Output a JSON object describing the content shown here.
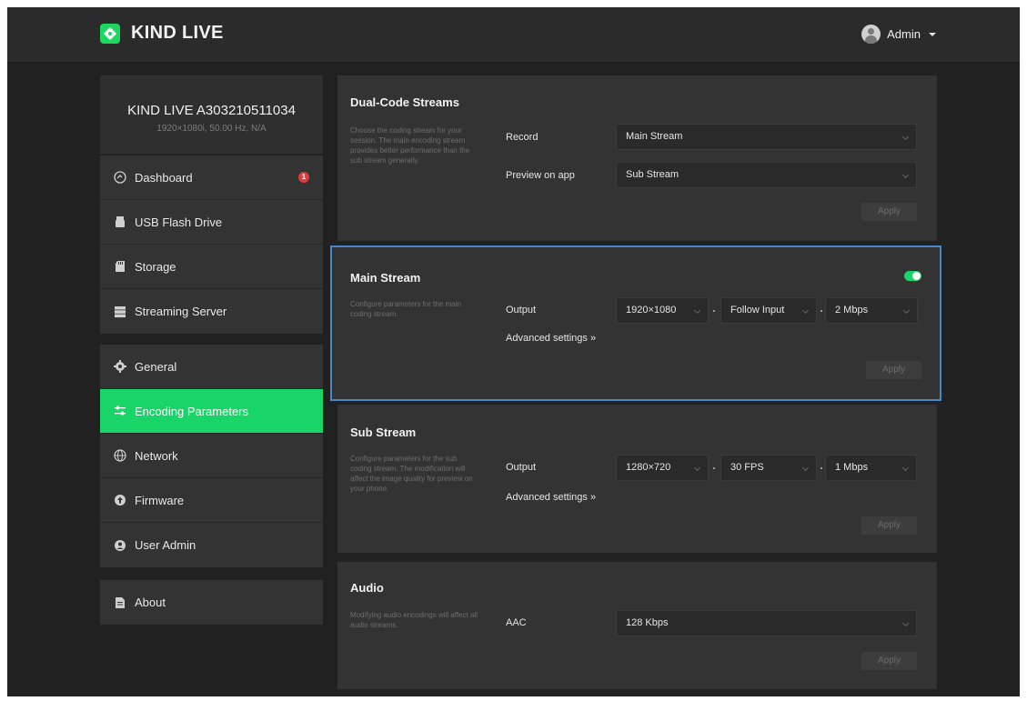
{
  "header": {
    "brand": "KIND LIVE",
    "user": "Admin"
  },
  "device": {
    "name": "KIND LIVE A303210511034",
    "info": "1920×1080i, 50.00 Hz, N/A"
  },
  "sidebar": {
    "group1": [
      {
        "label": "Dashboard",
        "icon": "dashboard-icon",
        "badge": "1"
      },
      {
        "label": "USB Flash Drive",
        "icon": "usb-drive-icon"
      },
      {
        "label": "Storage",
        "icon": "sd-card-icon"
      },
      {
        "label": "Streaming Server",
        "icon": "server-icon"
      }
    ],
    "group2": [
      {
        "label": "General",
        "icon": "gear-icon"
      },
      {
        "label": "Encoding Parameters",
        "icon": "sliders-icon",
        "active": true
      },
      {
        "label": "Network",
        "icon": "globe-icon"
      },
      {
        "label": "Firmware",
        "icon": "upload-icon"
      },
      {
        "label": "User Admin",
        "icon": "user-icon"
      }
    ],
    "group3": [
      {
        "label": "About",
        "icon": "document-icon"
      }
    ]
  },
  "dual_code": {
    "title": "Dual-Code Streams",
    "description": "Choose the coding stream for your session. The main encoding stream provides better performance than the sub stream generally.",
    "record_label": "Record",
    "record_value": "Main Stream",
    "preview_label": "Preview on app",
    "preview_value": "Sub Stream",
    "apply": "Apply"
  },
  "main_stream": {
    "title": "Main Stream",
    "description": "Configure parameters for the main coding stream.",
    "output_label": "Output",
    "resolution": "1920×1080",
    "framerate": "Follow Input",
    "bitrate": "2 Mbps",
    "advanced": "Advanced settings »",
    "apply": "Apply",
    "enabled": true
  },
  "sub_stream": {
    "title": "Sub Stream",
    "description": "Configure parameters for the sub coding stream. The modification will affect the image quality for preview on your phone.",
    "output_label": "Output",
    "resolution": "1280×720",
    "framerate": "30 FPS",
    "bitrate": "1 Mbps",
    "advanced": "Advanced settings »",
    "apply": "Apply"
  },
  "audio": {
    "title": "Audio",
    "description": "Modifying audio encodings will affect all audio streams.",
    "codec_label": "AAC",
    "bitrate": "128 Kbps",
    "apply": "Apply"
  },
  "colors": {
    "accent": "#19d466",
    "highlight_border": "#4a86c8",
    "badge": "#e03c3c"
  }
}
